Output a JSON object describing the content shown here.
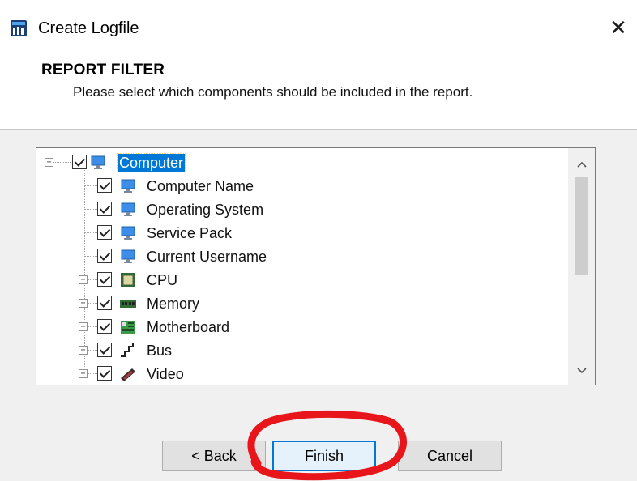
{
  "window": {
    "title": "Create Logfile",
    "close_symbol": "✕",
    "app_icon": "hwinfo-app-icon"
  },
  "header": {
    "title": "REPORT FILTER",
    "description": "Please select which components should be included in the report."
  },
  "tree": {
    "items": [
      {
        "label": "Computer",
        "checked": true,
        "icon": "monitor-icon",
        "level": 0,
        "expander": "minus",
        "selected": true
      },
      {
        "label": "Computer Name",
        "checked": true,
        "icon": "monitor-icon",
        "level": 1
      },
      {
        "label": "Operating System",
        "checked": true,
        "icon": "monitor-icon",
        "level": 1
      },
      {
        "label": "Service Pack",
        "checked": true,
        "icon": "monitor-icon",
        "level": 1
      },
      {
        "label": "Current Username",
        "checked": true,
        "icon": "monitor-icon",
        "level": 1
      },
      {
        "label": "CPU",
        "checked": true,
        "icon": "cpu-chip-icon",
        "level": 1,
        "expander": "plus"
      },
      {
        "label": "Memory",
        "checked": true,
        "icon": "memory-module-icon",
        "level": 1,
        "expander": "plus"
      },
      {
        "label": "Motherboard",
        "checked": true,
        "icon": "motherboard-icon",
        "level": 1,
        "expander": "plus"
      },
      {
        "label": "Bus",
        "checked": true,
        "icon": "bus-icon",
        "level": 1,
        "expander": "plus"
      },
      {
        "label": "Video",
        "checked": true,
        "icon": "video-card-icon",
        "level": 1,
        "expander": "plus"
      }
    ]
  },
  "scrollbar": {
    "up_arrow": "^",
    "down_arrow": "v"
  },
  "buttons": {
    "back_prefix": "< ",
    "back_accel": "B",
    "back_rest": "ack",
    "finish": "Finish",
    "cancel": "Cancel"
  },
  "annotation": {
    "color": "#e8161b"
  },
  "colors": {
    "selection": "#0078d7",
    "default_button_border": "#0078d7"
  }
}
